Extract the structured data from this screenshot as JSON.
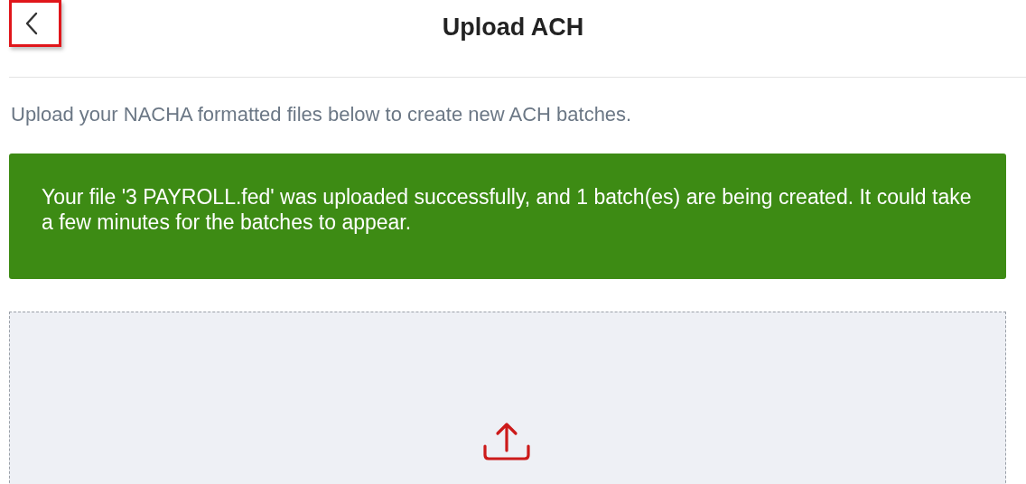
{
  "header": {
    "title": "Upload ACH",
    "back_button": {
      "highlighted": true
    }
  },
  "intro": "Upload your NACHA formatted files below to create new ACH batches.",
  "success_banner": {
    "message": "Your file '3 PAYROLL.fed' was uploaded successfully, and 1 batch(es) are being created. It could take a few minutes for the batches to appear."
  },
  "dropzone": {
    "kind": "upload"
  }
}
